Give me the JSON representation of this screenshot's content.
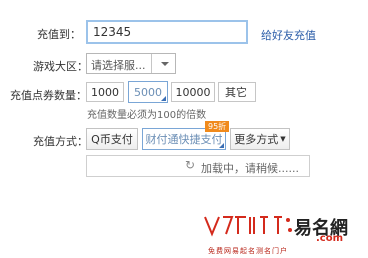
{
  "form": {
    "recharge_to_label": "充值到：",
    "account_value": "12345",
    "friend_link": "给好友充值",
    "server_label": "游戏大区：",
    "server_placeholder": "请选择服...",
    "points_label": "充值点券数量：",
    "amounts": [
      "1000",
      "5000",
      "10000"
    ],
    "selected_amount": "5000",
    "other_label": "其它",
    "hint": "充值数量必须为100的倍数",
    "method_label": "充值方式：",
    "methods": [
      "Q币支付",
      "财付通快捷支付"
    ],
    "selected_method": "财付通快捷支付",
    "discount_badge": "95折",
    "more_methods": "更多方式",
    "loading_text": "加载中，请稍候......"
  },
  "watermark": {
    "brand_cn": "易名網",
    "domain": ".com",
    "tagline": "免费网易起名测名门户"
  },
  "colors": {
    "accent": "#2a5ca8",
    "badge": "#f08a1c",
    "watermark_red": "#d42a1c"
  }
}
